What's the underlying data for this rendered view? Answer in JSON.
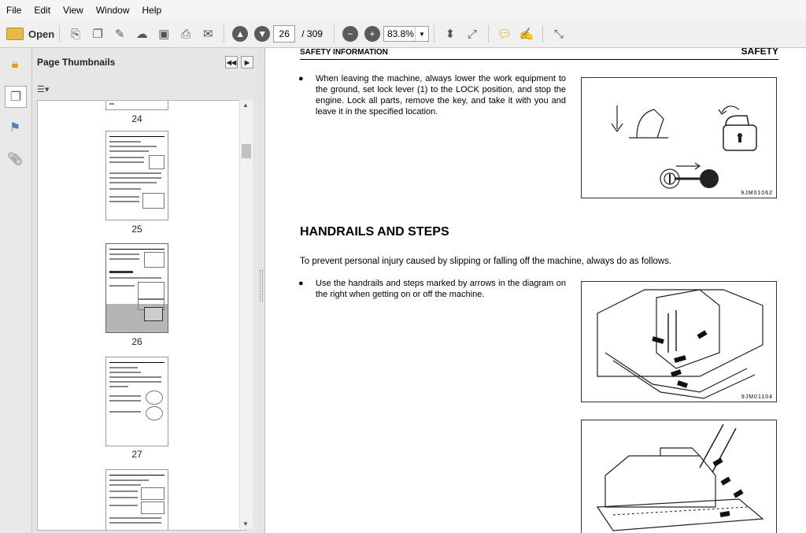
{
  "menu": [
    "File",
    "Edit",
    "View",
    "Window",
    "Help"
  ],
  "toolbar": {
    "open_label": "Open",
    "page_current": "26",
    "page_total": "/ 309",
    "zoom": "83.8%"
  },
  "panel": {
    "title": "Page Thumbnails",
    "page_labels": [
      "24",
      "25",
      "26",
      "27"
    ]
  },
  "document": {
    "header_left": "SAFETY INFORMATION",
    "header_right": "SAFETY",
    "bullet1": "When leaving the machine, always lower the work equipment to the ground, set lock lever (1) to the LOCK position, and stop the engine. Lock all parts, remove the key, and take it with you and leave it in the specified location.",
    "fig1_code": "9JM01062",
    "section_title": "HANDRAILS AND STEPS",
    "intro": "To prevent personal injury caused by slipping or falling off the machine, always do as follows.",
    "bullet2": "Use the handrails and steps marked by arrows in the diagram on the right when getting on or off the machine.",
    "fig2_code": "9JM01104"
  },
  "colors": {
    "toolbar_bg": "#f0f0f0",
    "panel_bg": "#e6e6e6",
    "selected_thumb": "#b4b4b4"
  }
}
